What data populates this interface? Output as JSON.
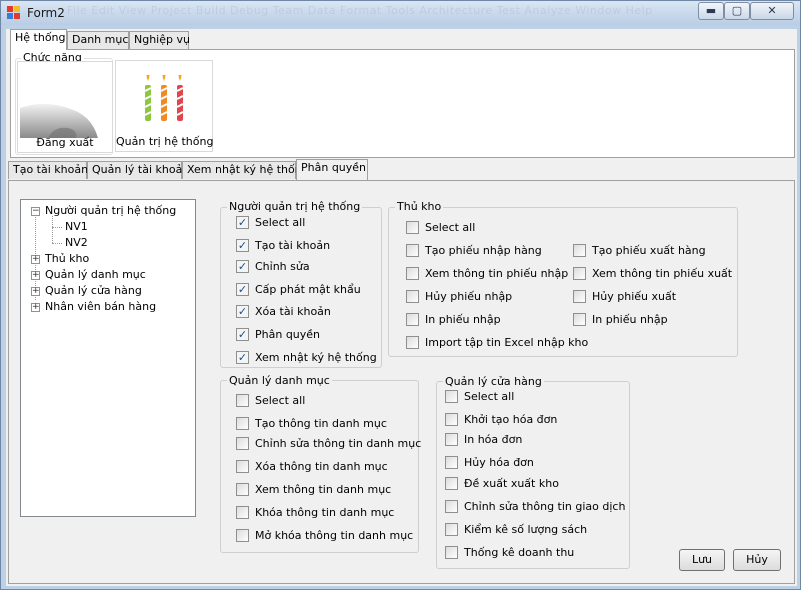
{
  "window": {
    "title": "Form2",
    "ghost_menu": "File   Edit   View   Project   Build   Debug   Team   Data   Format   Tools   Architecture   Test   Analyze   Window   Help",
    "minimize_glyph": "▬",
    "maximize_glyph": "▢",
    "close_glyph": "✕"
  },
  "top_tabs": [
    "Hệ thống",
    "Danh mục",
    "Nghiệp vụ"
  ],
  "functions": {
    "legend": "Chức năng",
    "logout_label": "Đăng xuất",
    "admin_label": "Quản trị hệ thống"
  },
  "sub_tabs": [
    "Tạo tài khoản",
    "Quản lý tài khoản",
    "Xem nhật ký hệ thống",
    "Phân quyền"
  ],
  "tree": {
    "roots": [
      "Người quản trị hệ thống",
      "Thủ kho",
      "Quản lý danh mục",
      "Quản lý cửa hàng",
      "Nhân viên bán hàng"
    ],
    "children": [
      "NV1",
      "NV2"
    ],
    "collapsed_glyph": "+",
    "expanded_glyph": "−"
  },
  "groups": {
    "admin": {
      "legend": "Người quản trị hệ thống",
      "items": [
        {
          "label": "Select all",
          "checked": true
        },
        {
          "label": "Tạo tài khoản",
          "checked": true
        },
        {
          "label": "Chỉnh sửa",
          "checked": true
        },
        {
          "label": "Cấp phát mật khẩu",
          "checked": true
        },
        {
          "label": "Xóa tài khoản",
          "checked": true
        },
        {
          "label": "Phân quyền",
          "checked": true
        },
        {
          "label": "Xem nhật ký hệ thống",
          "checked": true
        }
      ]
    },
    "warehouse": {
      "legend": "Thủ kho",
      "select_all": "Select all",
      "left": [
        "Tạo phiếu nhập hàng",
        "Xem thông tin phiếu nhập",
        "Hủy phiếu nhập",
        "In phiếu nhập",
        "Import tập tin Excel nhập kho"
      ],
      "right": [
        "Tạo phiếu xuất hàng",
        "Xem thông tin phiếu xuất",
        "Hủy phiếu xuất",
        "In phiếu nhập"
      ]
    },
    "catalog": {
      "legend": "Quản lý danh mục",
      "items": [
        "Select all",
        "Tạo thông tin danh mục",
        "Chỉnh sửa thông tin danh mục",
        "Xóa thông tin danh mục",
        "Xem thông tin danh mục",
        "Khóa thông tin danh mục",
        "Mở khóa thông tin danh mục"
      ]
    },
    "store": {
      "legend": "Quản lý cửa hàng",
      "items": [
        "Select all",
        "Khởi tạo hóa đơn",
        "In hóa đơn",
        "Hủy hóa đơn",
        "Đề xuất xuất kho",
        "Chỉnh sửa thông tin giao dịch",
        "Kiểm kê số lượng sách",
        "Thống kê doanh thu"
      ]
    }
  },
  "buttons": {
    "save": "Lưu",
    "cancel": "Hủy"
  },
  "check_glyph": "✓"
}
